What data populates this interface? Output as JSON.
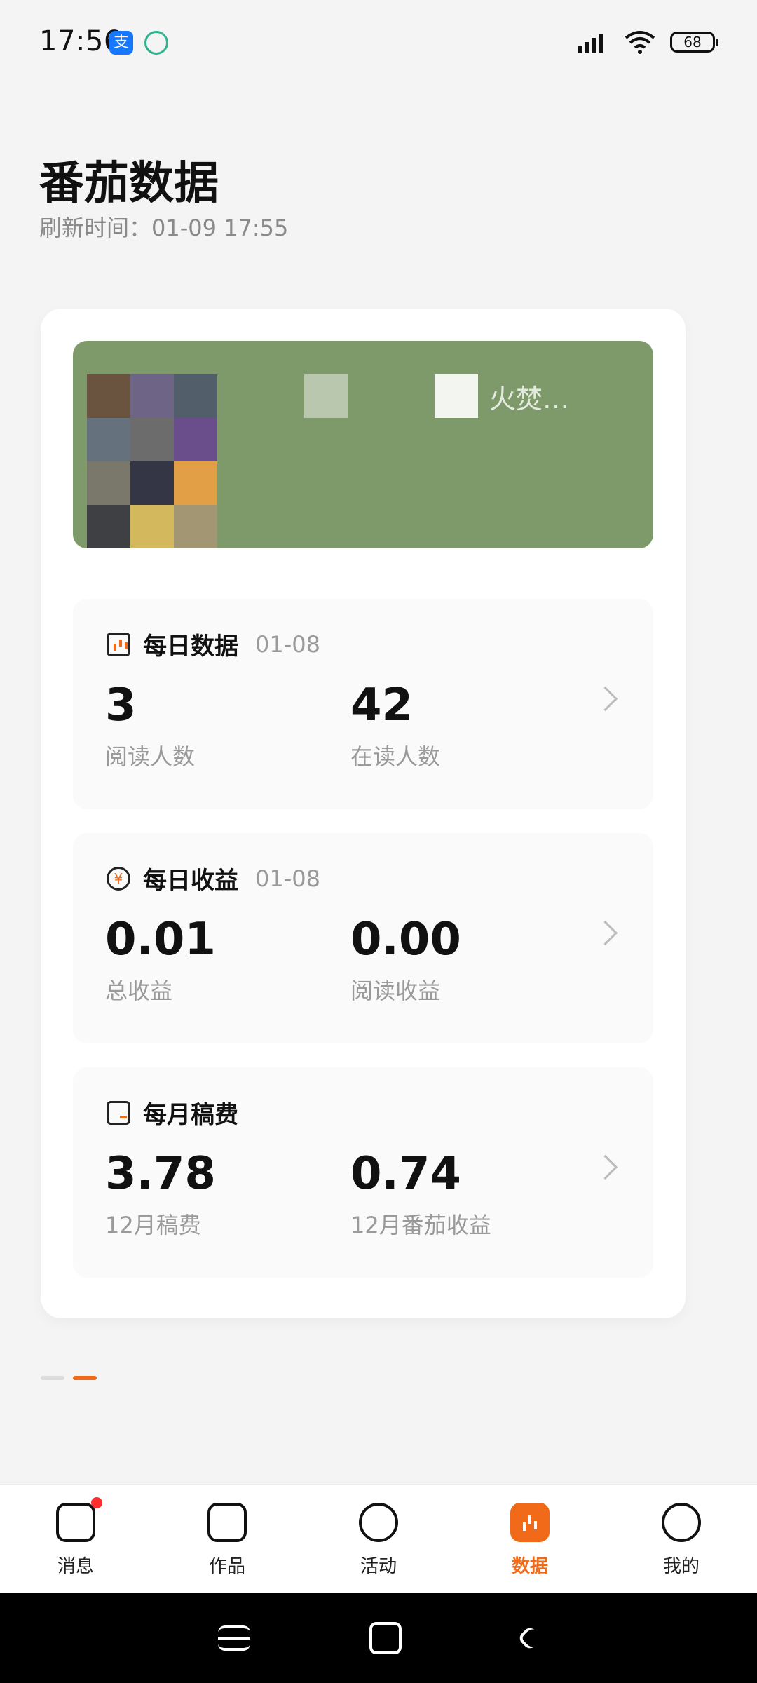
{
  "status_bar": {
    "time": "17:56",
    "battery": "68",
    "icons": [
      "alipay-icon",
      "leaf-icon",
      "signal-icon",
      "wifi-icon",
      "battery-icon"
    ]
  },
  "header": {
    "title": "番茄数据",
    "refresh_label": "刷新时间：",
    "refresh_time": "01-09 17:55"
  },
  "banner": {
    "title_fragment": "火焚…"
  },
  "daily_data": {
    "title": "每日数据",
    "date": "01-08",
    "stats": [
      {
        "value": "3",
        "label": "阅读人数"
      },
      {
        "value": "42",
        "label": "在读人数"
      }
    ]
  },
  "daily_income": {
    "title": "每日收益",
    "date": "01-08",
    "stats": [
      {
        "value": "0.01",
        "label": "总收益"
      },
      {
        "value": "0.00",
        "label": "阅读收益"
      }
    ]
  },
  "monthly_fee": {
    "title": "每月稿费",
    "stats": [
      {
        "value": "3.78",
        "label": "12月稿费"
      },
      {
        "value": "0.74",
        "label": "12月番茄收益"
      }
    ]
  },
  "bottom_nav": {
    "items": [
      {
        "label": "消息",
        "icon": "message-icon"
      },
      {
        "label": "作品",
        "icon": "works-icon"
      },
      {
        "label": "活动",
        "icon": "compass-icon"
      },
      {
        "label": "数据",
        "icon": "data-icon"
      },
      {
        "label": "我的",
        "icon": "profile-icon"
      }
    ]
  },
  "colors": {
    "accent": "#f06a1a",
    "badge": "#ff2d2d",
    "banner": "#7e9a6b"
  }
}
